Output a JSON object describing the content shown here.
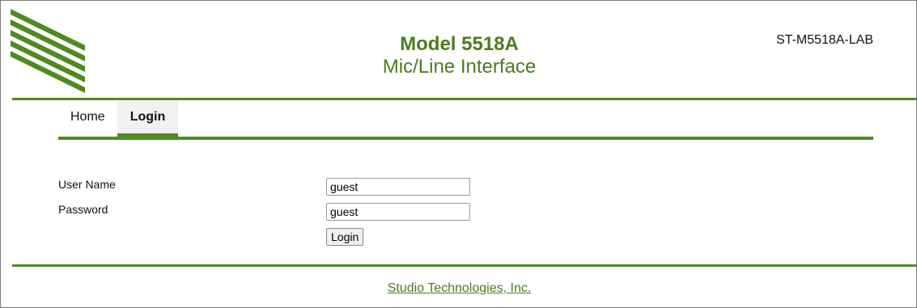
{
  "header": {
    "model": "Model 5518A",
    "subtitle": "Mic/Line Interface",
    "device_name": "ST-M5518A-LAB",
    "brand_color": "#4f8a1f"
  },
  "nav": {
    "items": [
      {
        "label": "Home",
        "active": false
      },
      {
        "label": "Login",
        "active": true
      }
    ]
  },
  "login_form": {
    "username_label": "User Name",
    "username_value": "guest",
    "password_label": "Password",
    "password_value": "guest",
    "submit_label": "Login"
  },
  "footer": {
    "link_text": "Studio Technologies, Inc."
  }
}
